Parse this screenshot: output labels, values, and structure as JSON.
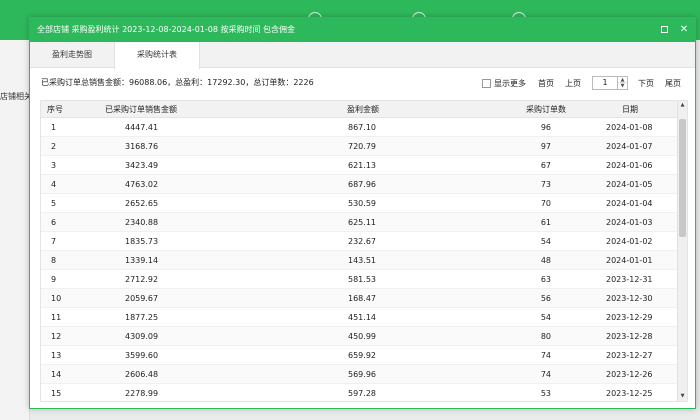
{
  "background": {
    "left_item": "店铺相关"
  },
  "dialog": {
    "title": "全部店铺 采购盈利统计 2023-12-08-2024-01-08 按采购时间 包含佣金",
    "tabs": [
      {
        "label": "盈利走势图"
      },
      {
        "label": "采购统计表"
      }
    ],
    "summary": "已采购订单总销售金额：96088.06，总盈利：17292.30，总订单数：2226",
    "pager": {
      "show_more": "显示更多",
      "first": "首页",
      "prev": "上页",
      "page": "1",
      "next": "下页",
      "last": "尾页"
    },
    "table": {
      "headers": {
        "no": "序号",
        "sales": "已采购订单销售金额",
        "profit": "盈利金额",
        "count": "采购订单数",
        "date": "日期"
      },
      "rows": [
        {
          "no": "1",
          "sales": "4447.41",
          "profit": "867.10",
          "count": "96",
          "date": "2024-01-08"
        },
        {
          "no": "2",
          "sales": "3168.76",
          "profit": "720.79",
          "count": "97",
          "date": "2024-01-07"
        },
        {
          "no": "3",
          "sales": "3423.49",
          "profit": "621.13",
          "count": "67",
          "date": "2024-01-06"
        },
        {
          "no": "4",
          "sales": "4763.02",
          "profit": "687.96",
          "count": "73",
          "date": "2024-01-05"
        },
        {
          "no": "5",
          "sales": "2652.65",
          "profit": "530.59",
          "count": "70",
          "date": "2024-01-04"
        },
        {
          "no": "6",
          "sales": "2340.88",
          "profit": "625.11",
          "count": "61",
          "date": "2024-01-03"
        },
        {
          "no": "7",
          "sales": "1835.73",
          "profit": "232.67",
          "count": "54",
          "date": "2024-01-02"
        },
        {
          "no": "8",
          "sales": "1339.14",
          "profit": "143.51",
          "count": "48",
          "date": "2024-01-01"
        },
        {
          "no": "9",
          "sales": "2712.92",
          "profit": "581.53",
          "count": "63",
          "date": "2023-12-31"
        },
        {
          "no": "10",
          "sales": "2059.67",
          "profit": "168.47",
          "count": "56",
          "date": "2023-12-30"
        },
        {
          "no": "11",
          "sales": "1877.25",
          "profit": "451.14",
          "count": "54",
          "date": "2023-12-29"
        },
        {
          "no": "12",
          "sales": "4309.09",
          "profit": "450.99",
          "count": "80",
          "date": "2023-12-28"
        },
        {
          "no": "13",
          "sales": "3599.60",
          "profit": "659.92",
          "count": "74",
          "date": "2023-12-27"
        },
        {
          "no": "14",
          "sales": "2606.48",
          "profit": "569.96",
          "count": "74",
          "date": "2023-12-26"
        },
        {
          "no": "15",
          "sales": "2278.99",
          "profit": "597.28",
          "count": "53",
          "date": "2023-12-25"
        }
      ]
    }
  },
  "colors": {
    "accent": "#2eb85c"
  }
}
